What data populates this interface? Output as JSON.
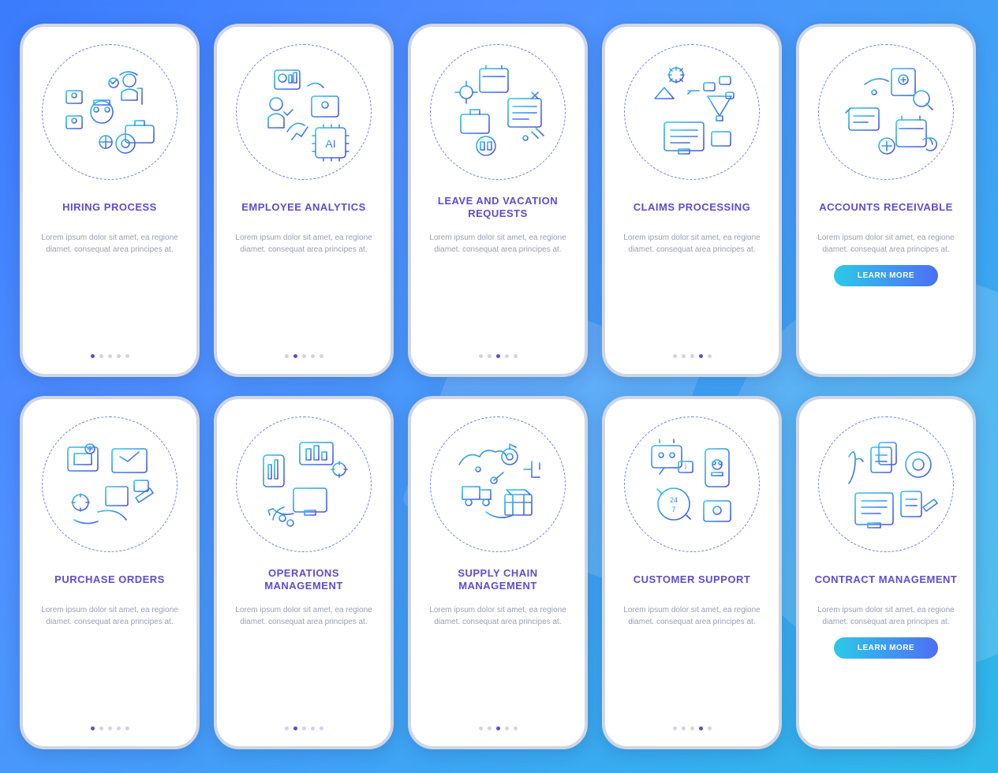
{
  "placeholder_body": "Lorem ipsum dolor sit amet, ea regione diamet. consequat area principes at.",
  "button_label": "LEARN MORE",
  "screens": [
    {
      "title": "HIRING PROCESS",
      "active_dot": 0,
      "has_button": false,
      "icon": "hiring"
    },
    {
      "title": "EMPLOYEE ANALYTICS",
      "active_dot": 1,
      "has_button": false,
      "icon": "analytics"
    },
    {
      "title": "LEAVE AND VACATION REQUESTS",
      "active_dot": 2,
      "has_button": false,
      "icon": "vacation"
    },
    {
      "title": "CLAIMS PROCESSING",
      "active_dot": 3,
      "has_button": false,
      "icon": "claims"
    },
    {
      "title": "ACCOUNTS RECEIVABLE",
      "active_dot": 4,
      "has_button": true,
      "icon": "accounts"
    },
    {
      "title": "PURCHASE ORDERS",
      "active_dot": 0,
      "has_button": false,
      "icon": "purchase"
    },
    {
      "title": "OPERATIONS MANAGEMENT",
      "active_dot": 1,
      "has_button": false,
      "icon": "operations"
    },
    {
      "title": "SUPPLY CHAIN MANAGEMENT",
      "active_dot": 2,
      "has_button": false,
      "icon": "supplychain"
    },
    {
      "title": "CUSTOMER SUPPORT",
      "active_dot": 3,
      "has_button": false,
      "icon": "support"
    },
    {
      "title": "CONTRACT MANAGEMENT",
      "active_dot": 4,
      "has_button": true,
      "icon": "contract"
    }
  ]
}
